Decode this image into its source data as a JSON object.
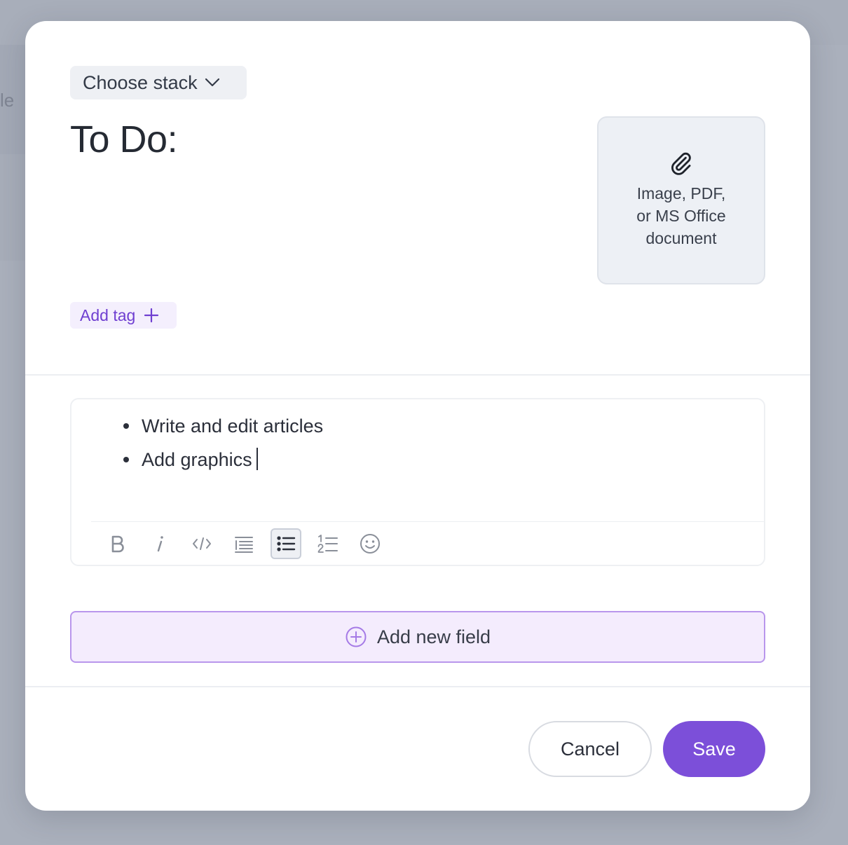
{
  "background": {
    "partial_text": "le"
  },
  "modal": {
    "stack_label": "Choose stack",
    "title": "To Do:",
    "attachment": {
      "icon": "paperclip-icon",
      "line1": "Image, PDF,",
      "line2": "or MS Office",
      "line3": "document"
    },
    "add_tag_label": "Add tag",
    "editor": {
      "items": [
        "Write and edit articles",
        "Add graphics"
      ],
      "toolbar": [
        {
          "name": "bold-icon",
          "active": false
        },
        {
          "name": "italic-icon",
          "active": false
        },
        {
          "name": "code-icon",
          "active": false
        },
        {
          "name": "indent-list-icon",
          "active": false
        },
        {
          "name": "bullet-list-icon",
          "active": true
        },
        {
          "name": "numbered-list-icon",
          "active": false
        },
        {
          "name": "emoji-icon",
          "active": false
        }
      ]
    },
    "add_field_label": "Add new field",
    "cancel_label": "Cancel",
    "save_label": "Save"
  },
  "colors": {
    "accent": "#7c4fd9",
    "tag_text": "#6f3fd1",
    "add_field_bg": "#f4ecfd",
    "add_field_border": "#b996ec",
    "overlay": "#aab0bc"
  }
}
